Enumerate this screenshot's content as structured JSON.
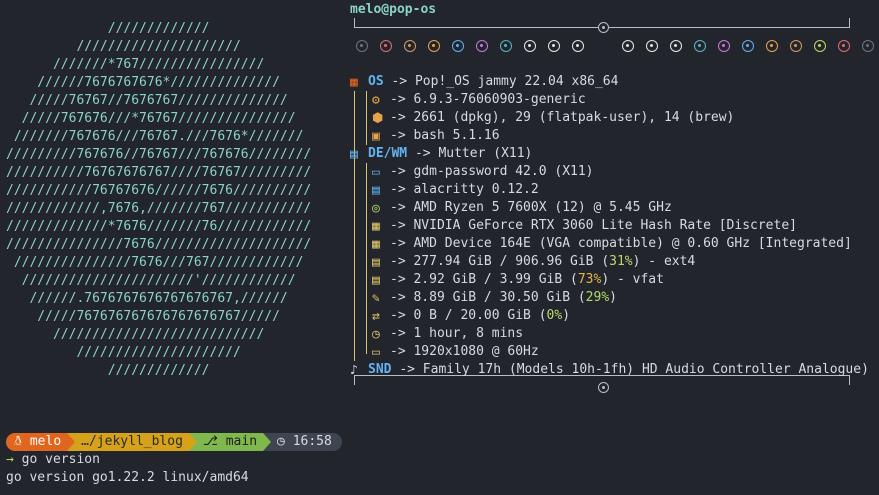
{
  "logo": {
    "lines": [
      "             /////////////",
      "         /////////////////////",
      "      ///////*767////////////////",
      "    //////7676767676*//////////////",
      "   /////76767//7676767//////////////",
      "  /////767676///*76767///////////////",
      " ///////767676///76767.///7676*///////",
      "/////////767676//76767///767676////////",
      "//////////76767676767////76767/////////",
      "///////////76767676//////7676//////////",
      "////////////,7676,///////767///////////",
      "/////////////*7676///////76////////////",
      "///////////////7676////////////////////",
      " ///////////////7676///767////////////",
      "  //////////////////////'////////////",
      "   //////.7676767676767676767,//////",
      "    /////767676767676767676767/////",
      "      ///////////////////////////",
      "         /////////////////////",
      "             /////////////"
    ]
  },
  "header": {
    "user_host": "melo@pop-os"
  },
  "palette": {
    "left": [
      "#6e7380",
      "#e06c75",
      "#d19a66",
      "#e5a34b",
      "#61afef",
      "#c678dd",
      "#56b6c2",
      "#e6e6e6",
      "#e6e6e6",
      "#e6e6e6"
    ],
    "right": [
      "#e6e6e6",
      "#e6e6e6",
      "#e6e6e6",
      "#56b6c2",
      "#c678dd",
      "#61afef",
      "#e5a34b",
      "#d19a66",
      "#b8d96a",
      "#e06c75",
      "#6e7380"
    ]
  },
  "arrow": "->",
  "os": {
    "key": "OS",
    "value": "Pop!_OS jammy 22.04 x86_64",
    "items": [
      {
        "icon": "gear-icon",
        "value": "6.9.3-76060903-generic"
      },
      {
        "icon": "package-icon",
        "value": "2661 (dpkg), 29 (flatpak-user), 14 (brew)"
      },
      {
        "icon": "terminal-icon",
        "value": "bash 5.1.16"
      }
    ]
  },
  "dewm": {
    "key": "DE/WM",
    "value": "Mutter (X11)",
    "items": [
      {
        "icon": "monitor-icon",
        "value": "gdm-password 42.0 (X11)"
      },
      {
        "icon": "terminal-window-icon",
        "value": "alacritty 0.12.2"
      },
      {
        "icon": "cpu-icon",
        "value": "AMD Ryzen 5 7600X (12) @ 5.45 GHz"
      },
      {
        "icon": "chip-icon",
        "value": "NVIDIA GeForce RTX 3060 Lite Hash Rate [Discrete]"
      },
      {
        "icon": "chip-icon",
        "value": "AMD Device 164E (VGA compatible) @ 0.60 GHz [Integrated]"
      },
      {
        "icon": "disk-icon",
        "value": "277.94 GiB / 906.96 GiB (",
        "pct": "31%",
        "tail": ") - ext4",
        "pct_color": "g"
      },
      {
        "icon": "disk-icon",
        "value": "2.92 GiB / 3.99 GiB (",
        "pct": "73%",
        "tail": ") - vfat",
        "pct_color": "y"
      },
      {
        "icon": "memory-icon",
        "value": "8.89 GiB / 30.50 GiB (",
        "pct": "29%",
        "tail": ")",
        "pct_color": "g"
      },
      {
        "icon": "swap-icon",
        "value": "0 B / 20.00 GiB (",
        "pct": "0%",
        "tail": ")",
        "pct_color": "g"
      },
      {
        "icon": "clock-icon",
        "value": "1 hour, 8 mins"
      },
      {
        "icon": "display-icon",
        "value": "1920x1080 @ 60Hz"
      }
    ]
  },
  "snd": {
    "key": "SND",
    "value": "Family 17h (Models 10h-1fh) HD Audio Controller Analogue)"
  },
  "prompt": {
    "user": "melo",
    "path": "…/jekyll_blog",
    "branch": "main",
    "time": "16:58",
    "colors": {
      "user": "#e0661f",
      "path": "#d6a21c",
      "branch": "#7fb94e",
      "time": "#3f4451"
    }
  },
  "terminal": {
    "command": "go version",
    "output": "go version go1.22.2 linux/amd64"
  }
}
